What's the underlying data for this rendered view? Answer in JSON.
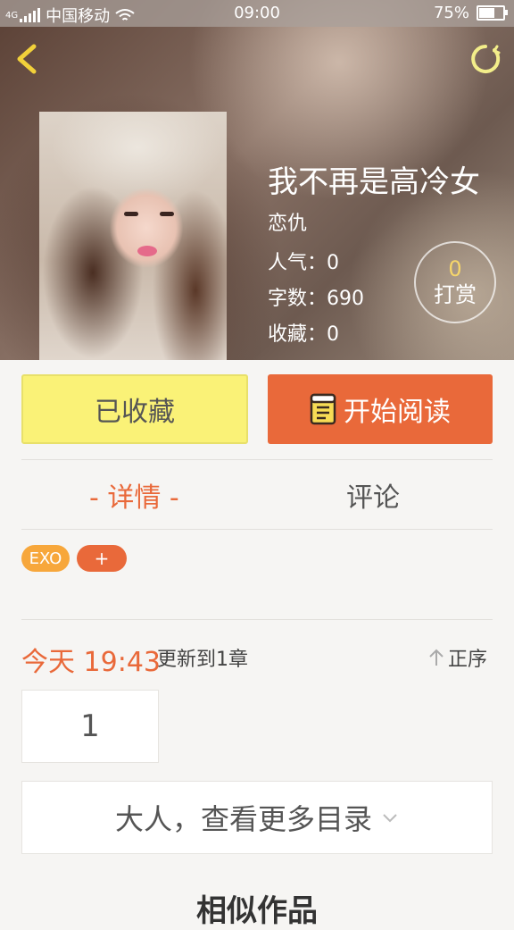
{
  "status_bar": {
    "network": "4G",
    "carrier": "中国移动",
    "time": "09:00",
    "battery": "75%",
    "battery_level": 0.75
  },
  "book": {
    "title": "我不再是高冷女",
    "author": "恋仇",
    "stats": [
      {
        "label": "人气：",
        "value": "0"
      },
      {
        "label": "字数：",
        "value": "690"
      },
      {
        "label": "收藏：",
        "value": "0"
      }
    ],
    "tip": {
      "count": "0",
      "label": "打赏"
    }
  },
  "actions": {
    "favorite_label": "已收藏",
    "read_label": "开始阅读"
  },
  "tabs": {
    "detail": "- 详情 -",
    "comment": "评论"
  },
  "tags": {
    "items": [
      "EXO"
    ],
    "add": "+"
  },
  "update": {
    "time": "今天 19:43",
    "text": "更新到1章",
    "sort_label": "正序"
  },
  "chapters": [
    "1"
  ],
  "more_catalog": "大人，查看更多目录",
  "similar_title": "相似作品",
  "colors": {
    "accent": "#e9693a",
    "favorite_bg": "#faf277",
    "tag_orange": "#f7a73b",
    "tip_gold": "#f6d66a"
  }
}
